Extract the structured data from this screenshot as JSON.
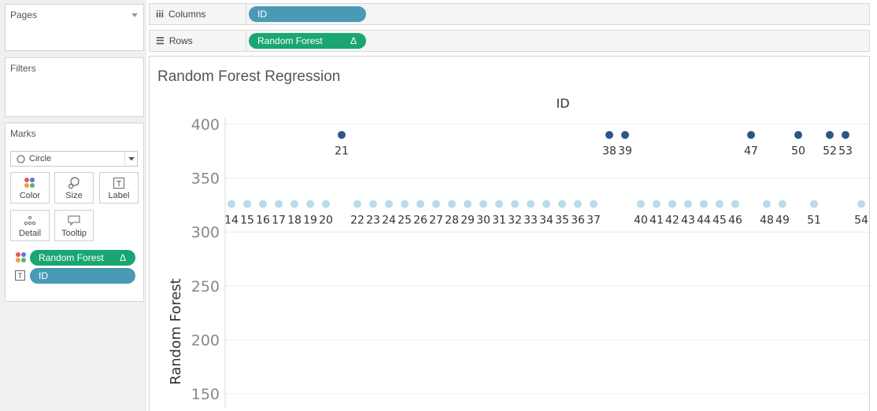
{
  "sidebar": {
    "pages": {
      "title": "Pages"
    },
    "filters": {
      "title": "Filters"
    },
    "marks": {
      "title": "Marks",
      "mark_type": "Circle",
      "buttons": [
        {
          "label": "Color",
          "icon": "color-icon"
        },
        {
          "label": "Size",
          "icon": "size-icon"
        },
        {
          "label": "Label",
          "icon": "label-icon"
        },
        {
          "label": "Detail",
          "icon": "detail-icon"
        },
        {
          "label": "Tooltip",
          "icon": "tooltip-icon"
        }
      ],
      "fields": [
        {
          "label": "Random Forest",
          "delta": "Δ",
          "encoding": "color"
        },
        {
          "label": "ID",
          "encoding": "label"
        }
      ]
    }
  },
  "shelves": {
    "columns": {
      "label": "Columns",
      "pill": "ID"
    },
    "rows": {
      "label": "Rows",
      "pill": "Random Forest",
      "delta": "Δ"
    }
  },
  "chart_title": "Random Forest Regression",
  "colors": {
    "pill_blue": "#4a9ab5",
    "pill_green": "#1aa672",
    "point_dark": "#2b5788",
    "point_light": "#b9dbea"
  },
  "chart_data": {
    "type": "scatter",
    "xlabel": "ID",
    "ylabel": "Random Forest",
    "ylim": [
      140,
      405
    ],
    "yticks": [
      150,
      200,
      250,
      300,
      350,
      400
    ],
    "grid": true,
    "points": [
      {
        "id": "14",
        "y": 326,
        "group": "light"
      },
      {
        "id": "15",
        "y": 326,
        "group": "light"
      },
      {
        "id": "16",
        "y": 326,
        "group": "light"
      },
      {
        "id": "17",
        "y": 326,
        "group": "light"
      },
      {
        "id": "18",
        "y": 326,
        "group": "light"
      },
      {
        "id": "19",
        "y": 326,
        "group": "light"
      },
      {
        "id": "20",
        "y": 326,
        "group": "light"
      },
      {
        "id": "21",
        "y": 390,
        "group": "dark"
      },
      {
        "id": "22",
        "y": 326,
        "group": "light"
      },
      {
        "id": "23",
        "y": 326,
        "group": "light"
      },
      {
        "id": "24",
        "y": 326,
        "group": "light"
      },
      {
        "id": "25",
        "y": 326,
        "group": "light"
      },
      {
        "id": "26",
        "y": 326,
        "group": "light"
      },
      {
        "id": "27",
        "y": 326,
        "group": "light"
      },
      {
        "id": "28",
        "y": 326,
        "group": "light"
      },
      {
        "id": "29",
        "y": 326,
        "group": "light"
      },
      {
        "id": "30",
        "y": 326,
        "group": "light"
      },
      {
        "id": "31",
        "y": 326,
        "group": "light"
      },
      {
        "id": "32",
        "y": 326,
        "group": "light"
      },
      {
        "id": "33",
        "y": 326,
        "group": "light"
      },
      {
        "id": "34",
        "y": 326,
        "group": "light"
      },
      {
        "id": "35",
        "y": 326,
        "group": "light"
      },
      {
        "id": "36",
        "y": 326,
        "group": "light"
      },
      {
        "id": "37",
        "y": 326,
        "group": "light"
      },
      {
        "id": "38",
        "y": 390,
        "group": "dark"
      },
      {
        "id": "39",
        "y": 390,
        "group": "dark"
      },
      {
        "id": "40",
        "y": 326,
        "group": "light"
      },
      {
        "id": "41",
        "y": 326,
        "group": "light"
      },
      {
        "id": "42",
        "y": 326,
        "group": "light"
      },
      {
        "id": "43",
        "y": 326,
        "group": "light"
      },
      {
        "id": "44",
        "y": 326,
        "group": "light"
      },
      {
        "id": "45",
        "y": 326,
        "group": "light"
      },
      {
        "id": "46",
        "y": 326,
        "group": "light"
      },
      {
        "id": "47",
        "y": 390,
        "group": "dark"
      },
      {
        "id": "48",
        "y": 326,
        "group": "light"
      },
      {
        "id": "49",
        "y": 326,
        "group": "light"
      },
      {
        "id": "50",
        "y": 390,
        "group": "dark"
      },
      {
        "id": "51",
        "y": 326,
        "group": "light"
      },
      {
        "id": "52",
        "y": 390,
        "group": "dark"
      },
      {
        "id": "53",
        "y": 390,
        "group": "dark"
      },
      {
        "id": "54",
        "y": 326,
        "group": "light"
      }
    ]
  }
}
